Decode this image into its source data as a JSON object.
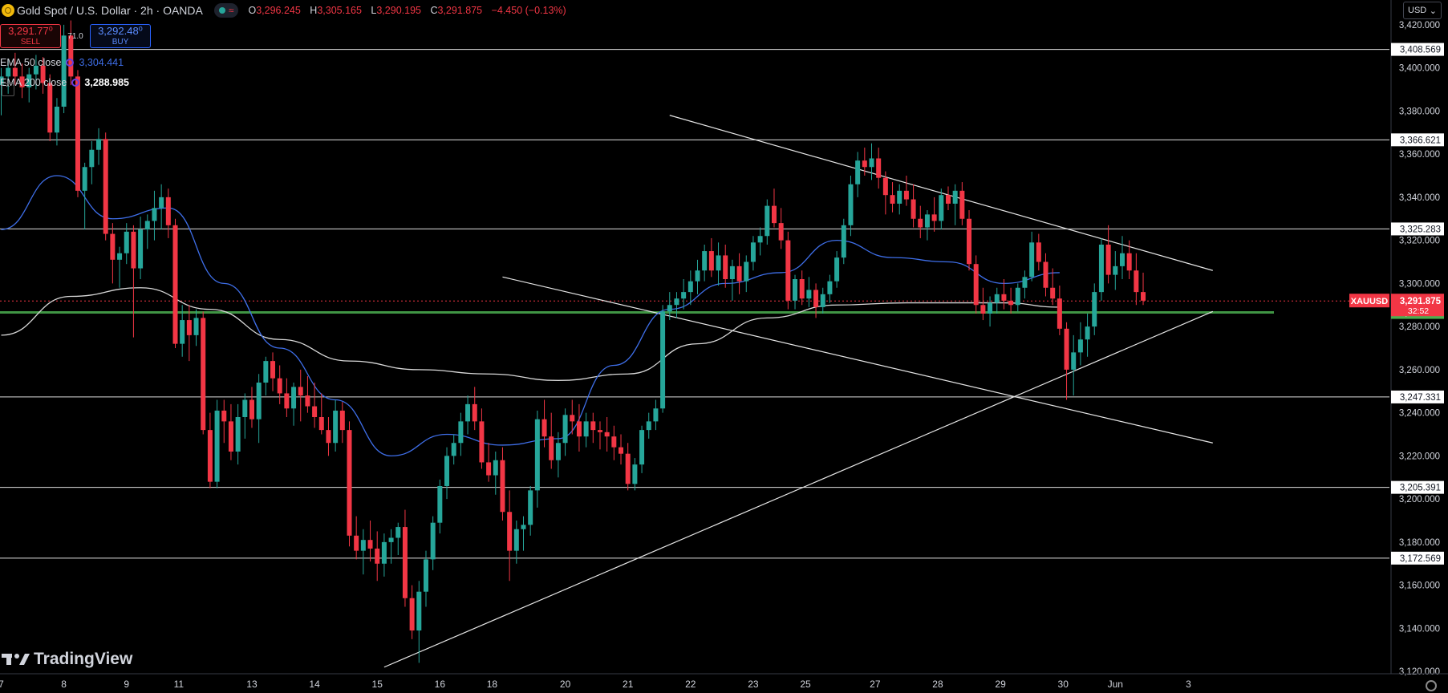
{
  "header": {
    "symbol": "Gold Spot / U.S. Dollar · 2h · OANDA",
    "o_label": "O",
    "o_value": "3,296.245",
    "h_label": "H",
    "h_value": "3,305.165",
    "l_label": "L",
    "l_value": "3,290.195",
    "c_label": "C",
    "c_value": "3,291.875",
    "change": "−4.450 (−0.13%)",
    "accent_up": "#26a69a",
    "accent_down": "#f23645"
  },
  "trade": {
    "sell_price": "3,291.77⁰",
    "sell_label": "SELL",
    "spread": "71.0",
    "buy_price": "3,292.48⁰",
    "buy_label": "BUY"
  },
  "indicators": {
    "ema50_label": "EMA 50 close",
    "ema50_value": "3,304.441",
    "ema50_color": "#3e6ee8",
    "ema200_label": "EMA 200 close",
    "ema200_value": "3,288.985",
    "ema200_color": "#d8d8d8"
  },
  "currency": "USD",
  "brand": "TradingView",
  "chart_data": {
    "type": "candlestick",
    "ylim": [
      3110,
      3430
    ],
    "y_ticks": [
      3120,
      3140,
      3160,
      3180,
      3200,
      3220,
      3240,
      3260,
      3280,
      3300,
      3320,
      3340,
      3360,
      3380,
      3400,
      3420
    ],
    "y_tick_labels": [
      "3,120.000",
      "3,140.000",
      "3,160.000",
      "3,180.000",
      "3,200.000",
      "3,220.000",
      "3,240.000",
      "3,260.000",
      "3,280.000",
      "3,300.000",
      "3,320.000",
      "3,340.000",
      "3,360.000",
      "3,380.000",
      "3,400.000",
      "3,420.000"
    ],
    "x_ticks": [
      {
        "label": "7",
        "i": 0
      },
      {
        "label": "8",
        "i": 9
      },
      {
        "label": "9",
        "i": 18
      },
      {
        "label": "11",
        "i": 25.5
      },
      {
        "label": "13",
        "i": 36
      },
      {
        "label": "14",
        "i": 45
      },
      {
        "label": "15",
        "i": 54
      },
      {
        "label": "16",
        "i": 63
      },
      {
        "label": "18",
        "i": 70.5
      },
      {
        "label": "20",
        "i": 81
      },
      {
        "label": "21",
        "i": 90
      },
      {
        "label": "22",
        "i": 99
      },
      {
        "label": "23",
        "i": 108
      },
      {
        "label": "25",
        "i": 115.5
      },
      {
        "label": "27",
        "i": 125.5
      },
      {
        "label": "28",
        "i": 134.5
      },
      {
        "label": "29",
        "i": 143.5
      },
      {
        "label": "30",
        "i": 152.5
      },
      {
        "label": "Jun",
        "i": 160
      },
      {
        "label": "3",
        "i": 170.5
      }
    ],
    "candles": [
      [
        3392,
        3400,
        3378,
        3396
      ],
      [
        3396,
        3404,
        3388,
        3400
      ],
      [
        3400,
        3407,
        3392,
        3396
      ],
      [
        3396,
        3402,
        3386,
        3391
      ],
      [
        3391,
        3400,
        3384,
        3397
      ],
      [
        3397,
        3406,
        3390,
        3401
      ],
      [
        3401,
        3405,
        3388,
        3393
      ],
      [
        3393,
        3397,
        3366,
        3370
      ],
      [
        3370,
        3386,
        3364,
        3382
      ],
      [
        3382,
        3420,
        3379,
        3415
      ],
      [
        3415,
        3422,
        3392,
        3396
      ],
      [
        3396,
        3399,
        3340,
        3343
      ],
      [
        3343,
        3356,
        3325,
        3354
      ],
      [
        3354,
        3366,
        3346,
        3362
      ],
      [
        3362,
        3372,
        3355,
        3367
      ],
      [
        3367,
        3370,
        3320,
        3323
      ],
      [
        3323,
        3328,
        3300,
        3311
      ],
      [
        3311,
        3317,
        3298,
        3314
      ],
      [
        3314,
        3328,
        3309,
        3324
      ],
      [
        3324,
        3327,
        3275,
        3307
      ],
      [
        3307,
        3331,
        3302,
        3325
      ],
      [
        3325,
        3332,
        3316,
        3329
      ],
      [
        3329,
        3343,
        3320,
        3335
      ],
      [
        3335,
        3346,
        3325,
        3340
      ],
      [
        3340,
        3344,
        3321,
        3327
      ],
      [
        3327,
        3330,
        3270,
        3272
      ],
      [
        3272,
        3290,
        3266,
        3283
      ],
      [
        3283,
        3290,
        3264,
        3276
      ],
      [
        3276,
        3288,
        3271,
        3284
      ],
      [
        3284,
        3287,
        3230,
        3232
      ],
      [
        3232,
        3240,
        3205,
        3208
      ],
      [
        3208,
        3246,
        3205,
        3241
      ],
      [
        3241,
        3246,
        3226,
        3236
      ],
      [
        3236,
        3244,
        3218,
        3222
      ],
      [
        3222,
        3244,
        3216,
        3238
      ],
      [
        3238,
        3249,
        3228,
        3246
      ],
      [
        3246,
        3252,
        3233,
        3237
      ],
      [
        3237,
        3258,
        3226,
        3254
      ],
      [
        3254,
        3266,
        3248,
        3264
      ],
      [
        3264,
        3268,
        3250,
        3256
      ],
      [
        3256,
        3262,
        3244,
        3249
      ],
      [
        3249,
        3256,
        3238,
        3242
      ],
      [
        3242,
        3254,
        3234,
        3252
      ],
      [
        3252,
        3260,
        3236,
        3248
      ],
      [
        3248,
        3257,
        3240,
        3243
      ],
      [
        3243,
        3254,
        3233,
        3238
      ],
      [
        3238,
        3249,
        3230,
        3232
      ],
      [
        3232,
        3238,
        3220,
        3226
      ],
      [
        3226,
        3246,
        3222,
        3241
      ],
      [
        3241,
        3245,
        3226,
        3232
      ],
      [
        3232,
        3236,
        3178,
        3183
      ],
      [
        3183,
        3192,
        3172,
        3176
      ],
      [
        3176,
        3186,
        3165,
        3181
      ],
      [
        3181,
        3190,
        3171,
        3177
      ],
      [
        3177,
        3185,
        3162,
        3170
      ],
      [
        3170,
        3184,
        3164,
        3180
      ],
      [
        3180,
        3186,
        3170,
        3182
      ],
      [
        3182,
        3189,
        3174,
        3187
      ],
      [
        3187,
        3195,
        3150,
        3154
      ],
      [
        3154,
        3160,
        3135,
        3139
      ],
      [
        3139,
        3162,
        3124,
        3157
      ],
      [
        3157,
        3176,
        3150,
        3172
      ],
      [
        3172,
        3192,
        3167,
        3189
      ],
      [
        3189,
        3209,
        3184,
        3206
      ],
      [
        3206,
        3224,
        3200,
        3220
      ],
      [
        3220,
        3230,
        3216,
        3226
      ],
      [
        3226,
        3240,
        3220,
        3236
      ],
      [
        3236,
        3248,
        3230,
        3244
      ],
      [
        3244,
        3252,
        3232,
        3236
      ],
      [
        3236,
        3242,
        3214,
        3217
      ],
      [
        3217,
        3226,
        3208,
        3211
      ],
      [
        3211,
        3222,
        3202,
        3218
      ],
      [
        3218,
        3224,
        3190,
        3194
      ],
      [
        3194,
        3204,
        3162,
        3176
      ],
      [
        3176,
        3190,
        3170,
        3186
      ],
      [
        3186,
        3192,
        3176,
        3188
      ],
      [
        3188,
        3206,
        3183,
        3204
      ],
      [
        3204,
        3241,
        3196,
        3237
      ],
      [
        3237,
        3246,
        3224,
        3229
      ],
      [
        3229,
        3240,
        3214,
        3218
      ],
      [
        3218,
        3231,
        3210,
        3226
      ],
      [
        3226,
        3242,
        3220,
        3239
      ],
      [
        3239,
        3246,
        3230,
        3236
      ],
      [
        3236,
        3244,
        3222,
        3229
      ],
      [
        3229,
        3240,
        3224,
        3236
      ],
      [
        3236,
        3240,
        3226,
        3232
      ],
      [
        3232,
        3236,
        3223,
        3231
      ],
      [
        3231,
        3238,
        3222,
        3229
      ],
      [
        3229,
        3234,
        3218,
        3224
      ],
      [
        3224,
        3230,
        3216,
        3221
      ],
      [
        3221,
        3226,
        3204,
        3207
      ],
      [
        3207,
        3219,
        3204,
        3216
      ],
      [
        3216,
        3234,
        3212,
        3232
      ],
      [
        3232,
        3240,
        3228,
        3236
      ],
      [
        3236,
        3246,
        3232,
        3242
      ],
      [
        3242,
        3290,
        3240,
        3287
      ],
      [
        3287,
        3296,
        3283,
        3290
      ],
      [
        3290,
        3296,
        3284,
        3293
      ],
      [
        3293,
        3302,
        3288,
        3296
      ],
      [
        3296,
        3306,
        3290,
        3301
      ],
      [
        3301,
        3311,
        3295,
        3306
      ],
      [
        3306,
        3318,
        3301,
        3315
      ],
      [
        3315,
        3321,
        3303,
        3306
      ],
      [
        3306,
        3319,
        3299,
        3313
      ],
      [
        3313,
        3318,
        3298,
        3302
      ],
      [
        3302,
        3311,
        3292,
        3308
      ],
      [
        3308,
        3314,
        3295,
        3301
      ],
      [
        3301,
        3313,
        3296,
        3310
      ],
      [
        3310,
        3322,
        3306,
        3319
      ],
      [
        3319,
        3326,
        3313,
        3322
      ],
      [
        3322,
        3339,
        3318,
        3336
      ],
      [
        3336,
        3344,
        3326,
        3328
      ],
      [
        3328,
        3335,
        3316,
        3320
      ],
      [
        3320,
        3324,
        3288,
        3292
      ],
      [
        3292,
        3304,
        3288,
        3302
      ],
      [
        3302,
        3306,
        3290,
        3293
      ],
      [
        3293,
        3303,
        3289,
        3297
      ],
      [
        3297,
        3300,
        3284,
        3289
      ],
      [
        3289,
        3298,
        3286,
        3295
      ],
      [
        3295,
        3304,
        3291,
        3301
      ],
      [
        3301,
        3315,
        3298,
        3312
      ],
      [
        3312,
        3330,
        3309,
        3327
      ],
      [
        3327,
        3350,
        3322,
        3346
      ],
      [
        3346,
        3361,
        3340,
        3357
      ],
      [
        3357,
        3363,
        3350,
        3354
      ],
      [
        3354,
        3365,
        3348,
        3358
      ],
      [
        3358,
        3363,
        3344,
        3349
      ],
      [
        3349,
        3352,
        3332,
        3341
      ],
      [
        3341,
        3347,
        3333,
        3337
      ],
      [
        3337,
        3346,
        3332,
        3343
      ],
      [
        3343,
        3350,
        3336,
        3339
      ],
      [
        3339,
        3346,
        3326,
        3330
      ],
      [
        3330,
        3336,
        3321,
        3326
      ],
      [
        3326,
        3334,
        3320,
        3332
      ],
      [
        3332,
        3340,
        3324,
        3329
      ],
      [
        3329,
        3344,
        3325,
        3341
      ],
      [
        3341,
        3345,
        3334,
        3337
      ],
      [
        3337,
        3346,
        3327,
        3343
      ],
      [
        3343,
        3347,
        3327,
        3330
      ],
      [
        3330,
        3334,
        3306,
        3309
      ],
      [
        3309,
        3313,
        3286,
        3290
      ],
      [
        3290,
        3298,
        3283,
        3286
      ],
      [
        3286,
        3294,
        3280,
        3291
      ],
      [
        3291,
        3298,
        3286,
        3295
      ],
      [
        3295,
        3302,
        3288,
        3292
      ],
      [
        3292,
        3298,
        3286,
        3290
      ],
      [
        3290,
        3300,
        3287,
        3298
      ],
      [
        3298,
        3306,
        3293,
        3303
      ],
      [
        3303,
        3324,
        3301,
        3319
      ],
      [
        3319,
        3323,
        3306,
        3310
      ],
      [
        3310,
        3314,
        3294,
        3298
      ],
      [
        3298,
        3307,
        3290,
        3293
      ],
      [
        3293,
        3299,
        3276,
        3279
      ],
      [
        3279,
        3282,
        3246,
        3260
      ],
      [
        3260,
        3276,
        3248,
        3268
      ],
      [
        3268,
        3282,
        3262,
        3274
      ],
      [
        3274,
        3286,
        3266,
        3280
      ],
      [
        3280,
        3300,
        3276,
        3296
      ],
      [
        3296,
        3321,
        3292,
        3318
      ],
      [
        3318,
        3327,
        3300,
        3304
      ],
      [
        3304,
        3315,
        3297,
        3308
      ],
      [
        3308,
        3322,
        3302,
        3314
      ],
      [
        3314,
        3320,
        3302,
        3306
      ],
      [
        3306,
        3314,
        3290,
        3296
      ],
      [
        3296,
        3305,
        3290,
        3292
      ]
    ],
    "hlines": [
      {
        "price": 3408.569,
        "label": "3,408.569"
      },
      {
        "price": 3366.621,
        "label": "3,366.621"
      },
      {
        "price": 3325.283,
        "label": "3,325.283"
      },
      {
        "price": 3247.331,
        "label": "3,247.331"
      },
      {
        "price": 3205.391,
        "label": "3,205.391"
      },
      {
        "price": 3172.569,
        "label": "3,172.569"
      }
    ],
    "support": {
      "price": 3286.535,
      "label": "3,286.535",
      "color": "#4caf50"
    },
    "last_price": {
      "price": 3291.875,
      "label": "3,291.875",
      "countdown": "32:52",
      "symbol": "XAUUSD",
      "color": "#f23645"
    },
    "trendlines": [
      {
        "p1": [
          96,
          3378
        ],
        "p2": [
          174,
          3306
        ]
      },
      {
        "p1": [
          72,
          3303
        ],
        "p2": [
          174,
          3226
        ]
      },
      {
        "p1": [
          55,
          3122
        ],
        "p2": [
          174,
          3287
        ]
      }
    ],
    "ema50_x": [
      0,
      8,
      16,
      24,
      32,
      40,
      48,
      56,
      64,
      72,
      80,
      88,
      96,
      104,
      112,
      120,
      128,
      136,
      144,
      152
    ],
    "ema50_y": [
      3325,
      3350,
      3330,
      3335,
      3300,
      3270,
      3246,
      3220,
      3230,
      3225,
      3228,
      3262,
      3288,
      3300,
      3305,
      3320,
      3312,
      3310,
      3300,
      3305
    ],
    "ema200_x": [
      0,
      10,
      20,
      30,
      40,
      50,
      60,
      70,
      80,
      90,
      100,
      110,
      120,
      130,
      144,
      152
    ],
    "ema200_y": [
      3276,
      3294,
      3298,
      3288,
      3274,
      3264,
      3260,
      3258,
      3255,
      3258,
      3272,
      3284,
      3290,
      3291,
      3291,
      3289
    ]
  }
}
